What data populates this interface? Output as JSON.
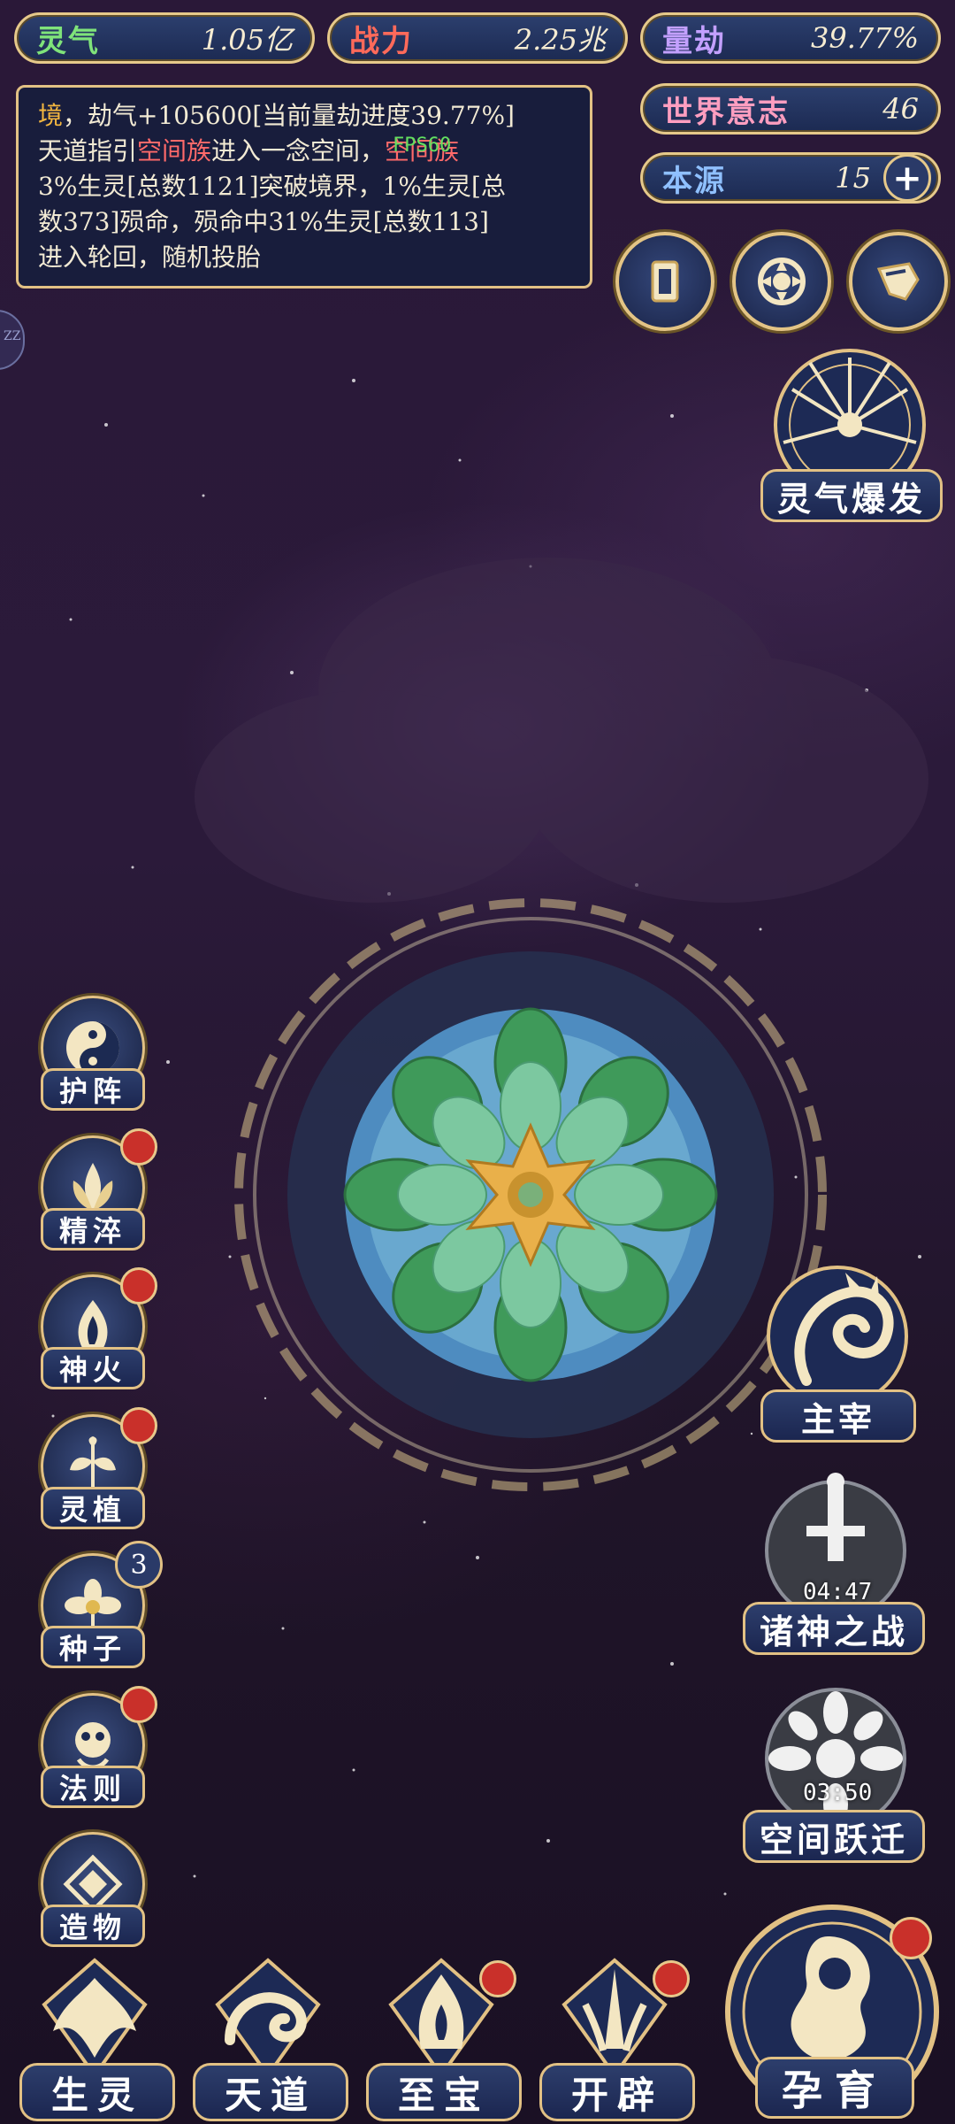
{
  "resources": {
    "lingqi": {
      "label": "灵气",
      "value": "1.05亿"
    },
    "zhanli": {
      "label": "战力",
      "value": "2.25兆"
    },
    "liangjie": {
      "label": "量劫",
      "value": "39.77%"
    },
    "shijie_yizhi": {
      "label": "世界意志",
      "value": "46"
    },
    "benyuan": {
      "label": "本源",
      "value": "15"
    }
  },
  "log": {
    "line1_prefix": "境",
    "line1_rest": "，劫气+105600[当前量劫进度39.77%]",
    "line2_a": "天道指引",
    "line2_race": "空间族",
    "line2_b": "进入一念空间，",
    "line2_race2": "空间族",
    "line3": "3%生灵[总数1121]突破境界，1%生灵[总",
    "line4": "数373]殒命，殒命中31%生灵[总数113]",
    "line5": "进入轮回，随机投胎"
  },
  "fps": "FPS60",
  "edge_tab": "ZZ",
  "right_buttons": {
    "burst": "灵气爆发",
    "master": "主宰",
    "war": "诸神之战",
    "war_timer": "04:47",
    "leap": "空间跃迁",
    "leap_timer": "03:50"
  },
  "left_buttons": [
    "护阵",
    "精淬",
    "神火",
    "灵植",
    "种子",
    "法则",
    "造物"
  ],
  "seed_badge": "3",
  "bottom_buttons": [
    "生灵",
    "天道",
    "至宝",
    "开辟"
  ],
  "breed_button": "孕育",
  "colors": {
    "gold": "#e2c184",
    "panel": "#1c2a52",
    "alert": "#c9302a"
  }
}
